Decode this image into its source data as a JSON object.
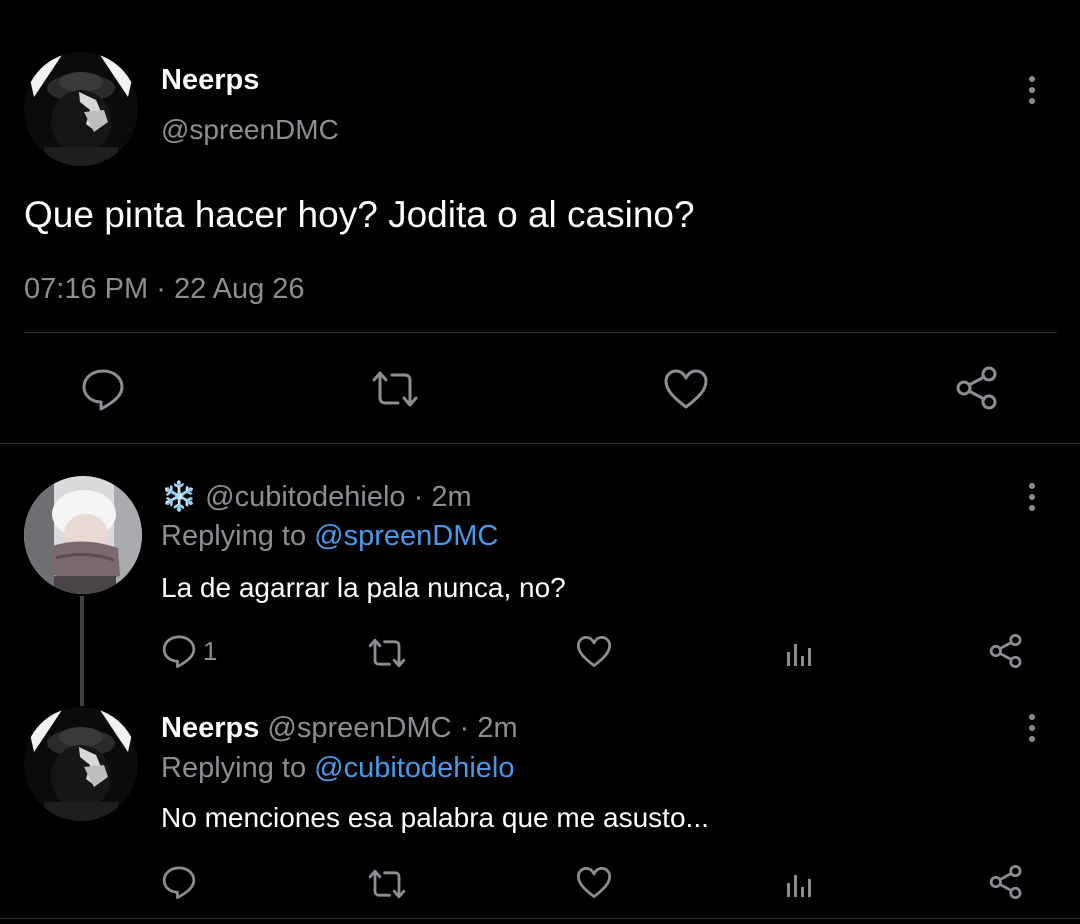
{
  "main_tweet": {
    "author_name": "Neerps",
    "author_handle": "@spreenDMC",
    "text": "Que pinta hacer hoy? Jodita o al casino?",
    "time": "07:16 PM",
    "separator": "·",
    "date": "22 Aug 26",
    "avatar_icon": "avatar-dark-cap-photo",
    "actions": {
      "reply_icon": "speech-bubble-icon",
      "retweet_icon": "retweet-arrows-icon",
      "like_icon": "heart-icon",
      "share_icon": "share-nodes-icon"
    }
  },
  "replies": [
    {
      "author_emoji": "❄️",
      "author_name": "",
      "author_handle": "@cubitodehielo",
      "time_sep": "·",
      "time_ago": "2m",
      "replying_prefix": "Replying to",
      "replying_to": "@spreenDMC",
      "text": "La de agarrar la pala nunca, no?",
      "reply_count": "1",
      "avatar_icon": "avatar-white-hair-photo"
    },
    {
      "author_emoji": "",
      "author_name": "Neerps",
      "author_handle": "@spreenDMC",
      "time_sep": "·",
      "time_ago": "2m",
      "replying_prefix": "Replying to",
      "replying_to": "@cubitodehielo",
      "text": "No menciones esa palabra que me asusto...",
      "reply_count": "",
      "avatar_icon": "avatar-dark-cap-photo"
    }
  ],
  "colors": {
    "background": "#000000",
    "text": "#e7e9ea",
    "secondary": "#8b8f94",
    "link": "#4a99e9",
    "divider": "#2f3336"
  }
}
